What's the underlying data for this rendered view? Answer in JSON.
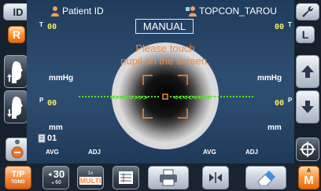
{
  "header": {
    "id_label": "ID",
    "patient_label": "Patient ID",
    "patient_name": "TOPCON_TAROU",
    "mode": "MANUAL"
  },
  "eye": {
    "right": "R",
    "left": "L"
  },
  "readouts": {
    "top_left": "00",
    "top_right": "00",
    "top_t_left": "T",
    "top_t_right": "T",
    "mid_left": "00",
    "mid_right": "00",
    "mid_p_left": "P",
    "mid_p_right": "P",
    "unit_mmhg": "mmHg",
    "unit_mm": "mm",
    "counter": "01",
    "avg": "AVG",
    "adj": "ADJ"
  },
  "message": {
    "line1": "Please touch",
    "line2": "pupil on the screen."
  },
  "toolbar": {
    "tp_label": "T/P",
    "tono_label": "TONO",
    "value_main": "30",
    "value_sub": "60",
    "multi_label": "MULTI",
    "m_label": "M",
    "a_label": "A"
  },
  "colors": {
    "accent": "#f08a3c",
    "readout": "#f5ef6a",
    "alignment": "#55e02a"
  }
}
